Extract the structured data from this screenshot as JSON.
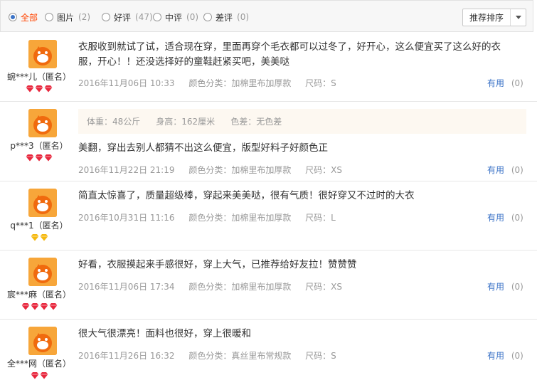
{
  "filters": [
    {
      "label": "全部",
      "count": "",
      "checked": true
    },
    {
      "label": "图片",
      "count": "(2)",
      "checked": false
    },
    {
      "label": "好评",
      "count": "(47)",
      "checked": false
    },
    {
      "label": "中评",
      "count": "(0)",
      "checked": false
    },
    {
      "label": "差评",
      "count": "(0)",
      "checked": false
    }
  ],
  "sort": {
    "label": "推荐排序"
  },
  "colors": {
    "accent": "#ff4400",
    "link": "#3b73c7",
    "avatar": "#f39c12",
    "diamond_red": "#e8273d",
    "diamond_gold": "#f5b90f"
  },
  "reviews": [
    {
      "user": "蜿***儿（匿名）",
      "rank": {
        "type": "red-diamond",
        "count": 3
      },
      "content": "衣服收到就试了试，适合现在穿，里面再穿个毛衣都可以过冬了，好开心，这么便宜买了这么好的衣服，开心！！还没选择好的童鞋赶紧买吧，美美哒",
      "date": "2016年11月06日 10:33",
      "color": "颜色分类：加棉里布加厚款",
      "size": "尺码：S",
      "useful_label": "有用",
      "useful_count": "(0)"
    },
    {
      "user": "p***3（匿名）",
      "rank": {
        "type": "red-diamond",
        "count": 3
      },
      "body": {
        "weight": "体重：48公斤",
        "height": "身高：162厘米",
        "color_diff": "色差：无色差"
      },
      "content": "美翻，穿出去别人都猜不出这么便宜，版型好料子好颜色正",
      "date": "2016年11月22日 21:19",
      "color": "颜色分类：加棉里布加厚款",
      "size": "尺码：XS",
      "useful_label": "有用",
      "useful_count": "(0)"
    },
    {
      "user": "q***1（匿名）",
      "rank": {
        "type": "gold-diamond",
        "count": 2
      },
      "content": "简直太惊喜了，质量超级棒，穿起来美美哒，很有气质！很好穿又不过时的大衣",
      "date": "2016年10月31日 11:16",
      "color": "颜色分类：加棉里布加厚款",
      "size": "尺码：L",
      "useful_label": "有用",
      "useful_count": "(0)"
    },
    {
      "user": "宸***麻（匿名）",
      "rank": {
        "type": "red-diamond",
        "count": 4
      },
      "content": "好看，衣服摸起来手感很好，穿上大气，已推荐给好友拉！赞赞赞",
      "date": "2016年11月06日 17:34",
      "color": "颜色分类：加棉里布加厚款",
      "size": "尺码：XS",
      "useful_label": "有用",
      "useful_count": "(0)"
    },
    {
      "user": "全***网（匿名）",
      "rank": {
        "type": "red-diamond",
        "count": 2
      },
      "content": "很大气很漂亮！面料也很好，穿上很暖和",
      "date": "2016年11月26日 16:32",
      "color": "颜色分类：真丝里布常规款",
      "size": "尺码：S",
      "useful_label": "有用",
      "useful_count": "(0)"
    }
  ]
}
